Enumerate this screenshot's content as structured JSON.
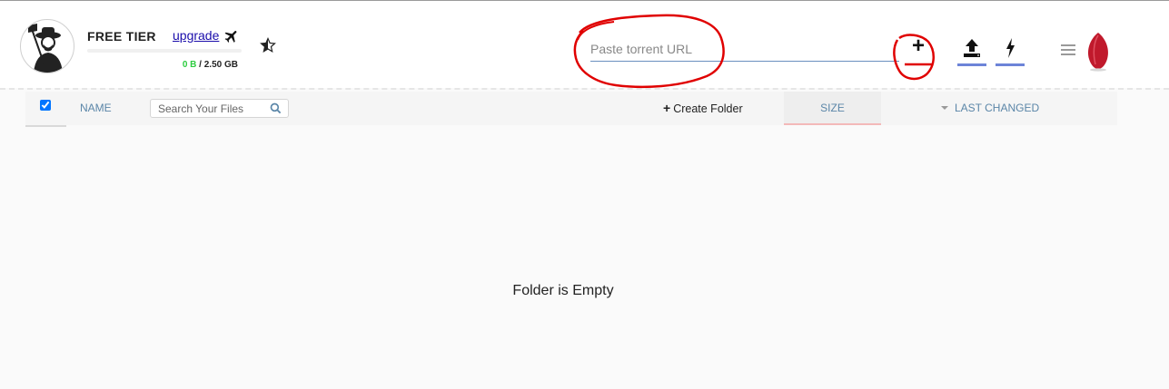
{
  "header": {
    "tier_label": "FREE TIER",
    "upgrade_label": "upgrade",
    "quota_used": "0 B",
    "quota_separator": " / ",
    "quota_total": "2.50 GB",
    "quota_fraction": 0.0
  },
  "torrent": {
    "placeholder": "Paste torrent URL",
    "value": ""
  },
  "toolbar": {
    "select_all_checked": true,
    "name_label": "NAME",
    "search_placeholder": "Search Your Files",
    "create_folder_label": "Create Folder",
    "size_label": "SIZE",
    "last_changed_label": "LAST CHANGED"
  },
  "main": {
    "empty_message": "Folder is Empty"
  },
  "icons": {
    "avatar": "avatar-icon",
    "plane": "plane-icon",
    "star": "star-half-icon",
    "add": "plus-icon",
    "upload": "upload-icon",
    "flash": "flash-icon",
    "menu": "hamburger-icon",
    "logo": "seedr-logo-icon",
    "search": "search-icon",
    "sort": "caret-down-icon"
  },
  "colors": {
    "accent_blue": "#6d84d8",
    "quota_green": "#2ecc40",
    "column_text": "#5b86a8",
    "logo_red": "#c0192c",
    "annotation_red": "#e00000",
    "size_underline": "#f3b9b9"
  }
}
